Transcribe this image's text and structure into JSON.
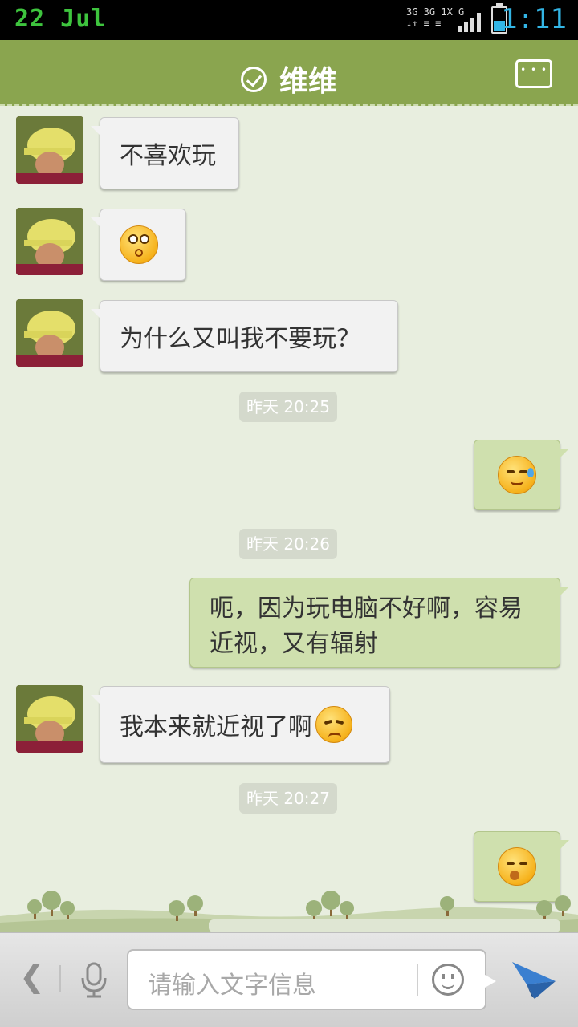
{
  "status_bar": {
    "date": "22 Jul",
    "time": "1:11",
    "network": [
      "3G 3G 1X G"
    ],
    "battery_level": 0.45
  },
  "header": {
    "title": "维维"
  },
  "messages": [
    {
      "side": "left",
      "text": "不喜欢玩"
    },
    {
      "side": "left",
      "emoji": "dizzy-emoji"
    },
    {
      "side": "left",
      "text": "为什么又叫我不要玩？"
    },
    {
      "timestamp": "昨天 20:25"
    },
    {
      "side": "right",
      "emoji": "sweat-emoji"
    },
    {
      "timestamp": "昨天 20:26"
    },
    {
      "side": "right",
      "text": "呃，因为玩电脑不好啊，容易近视，又有辐射"
    },
    {
      "side": "left",
      "text": "我本来就近视了啊",
      "emoji": "sad-emoji"
    },
    {
      "timestamp": "昨天 20:27"
    },
    {
      "side": "right",
      "emoji": "shy-emoji"
    }
  ],
  "texts": {
    "m1": "不喜欢玩",
    "m3": "为什么又叫我不要玩？",
    "ts1": "昨天 20:25",
    "ts2": "昨天 20:26",
    "m5": "呃，因为玩电脑不好啊，容易近视，又有辐射",
    "m6": "我本来就近视了啊",
    "ts3": "昨天 20:27"
  },
  "input": {
    "placeholder": "请输入文字信息"
  },
  "colors": {
    "header": "#8aa54f",
    "chat_bg": "#e8eedf",
    "right_bubble": "#cfe0ae",
    "left_bubble": "#f2f2f2",
    "send": "#3a7fd0"
  }
}
